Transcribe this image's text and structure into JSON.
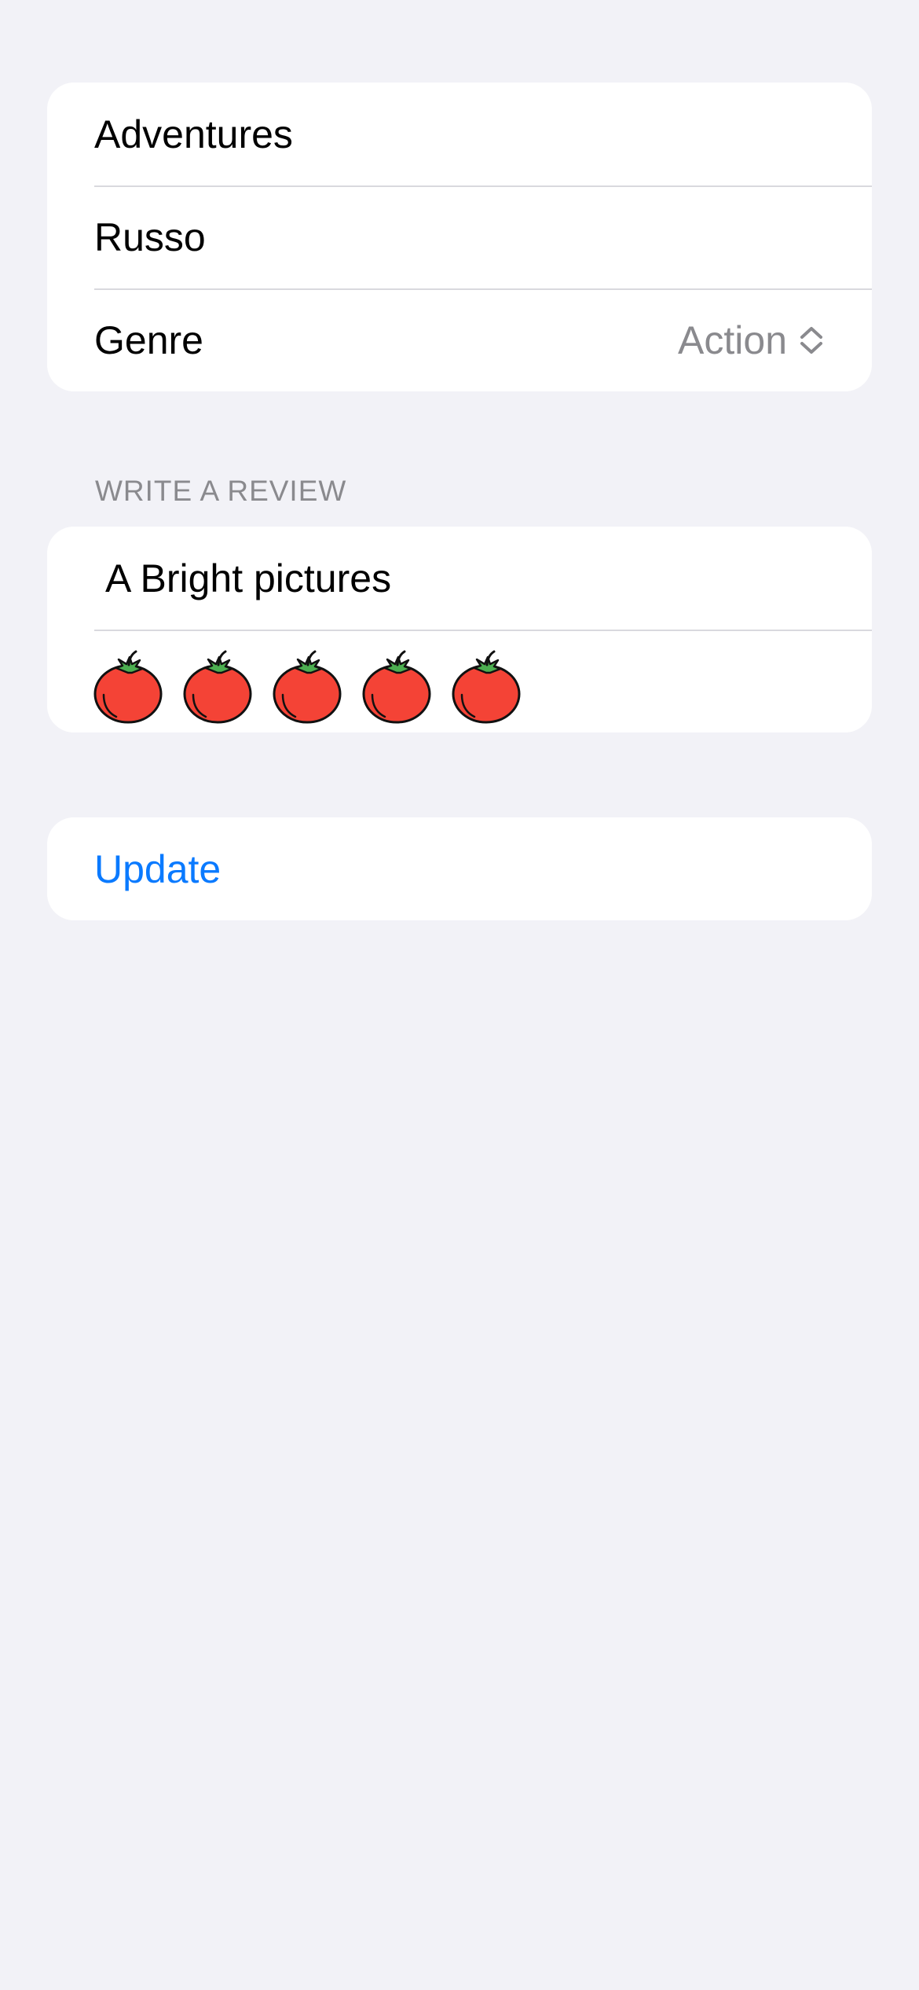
{
  "movie_form": {
    "title_value": "Adventures",
    "director_value": "Russo",
    "genre": {
      "label": "Genre",
      "selected": "Action",
      "icon": "chevron-up-down-icon"
    }
  },
  "review": {
    "section_header": "WRITE A REVIEW",
    "text_value": "A Bright pictures",
    "rating": {
      "value": 5,
      "max": 5,
      "icon": "tomato-icon"
    }
  },
  "actions": {
    "update_label": "Update"
  },
  "colors": {
    "background": "#f2f2f7",
    "accent": "#0a7aff",
    "secondary_text": "#8a8a8e",
    "tomato_red": "#f44336",
    "tomato_leaf": "#4caf50"
  }
}
